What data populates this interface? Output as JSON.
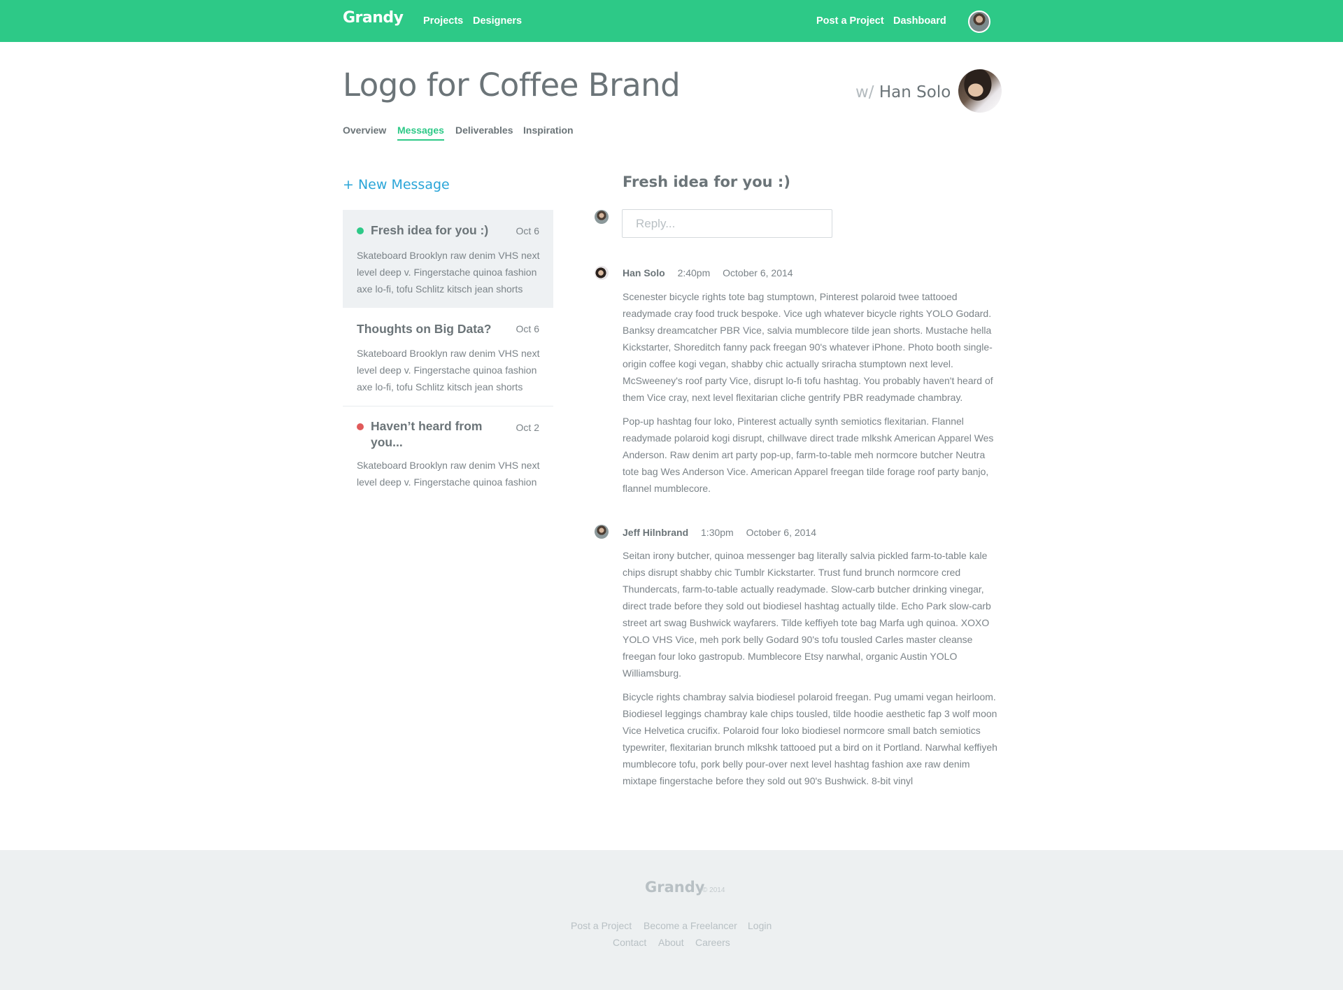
{
  "topbar": {
    "brand": "Grandy",
    "nav_left": [
      "Projects",
      "Designers"
    ],
    "nav_right": [
      "Post a Project",
      "Dashboard"
    ],
    "accent_color": "#2dc987"
  },
  "header": {
    "title": "Logo for Coffee Brand",
    "with_prefix": "w/",
    "with_name": "Han Solo",
    "tabs": [
      "Overview",
      "Messages",
      "Deliverables",
      "Inspiration"
    ],
    "active_tab": "Messages"
  },
  "sidebar": {
    "new_message": "+ New Message",
    "threads": [
      {
        "subject": "Fresh idea for you :)",
        "date": "Oct 6",
        "preview": "Skateboard Brooklyn raw denim VHS next level deep v. Fingerstache quinoa fashion axe lo-fi, tofu Schlitz kitsch jean shorts",
        "status_color": "#2dc987",
        "active": true
      },
      {
        "subject": "Thoughts on Big Data?",
        "date": "Oct 6",
        "preview": "Skateboard Brooklyn raw denim VHS next level deep v. Fingerstache quinoa fashion axe lo-fi, tofu Schlitz kitsch jean shorts",
        "status_color": "",
        "active": false
      },
      {
        "subject": "Haven’t heard from you...",
        "date": "Oct 2",
        "preview": "Skateboard Brooklyn raw denim VHS next level deep v. Fingerstache quinoa fashion",
        "status_color": "#e05a5a",
        "active": false
      }
    ]
  },
  "conversation": {
    "title": "Fresh idea for you :)",
    "reply_placeholder": "Reply...",
    "messages": [
      {
        "author": "Han Solo",
        "time": "2:40pm",
        "date": "October 6, 2014",
        "paragraphs": [
          "Scenester bicycle rights tote bag stumptown, Pinterest polaroid twee tattooed readymade cray food truck bespoke. Vice ugh whatever bicycle rights YOLO Godard. Banksy dreamcatcher PBR Vice, salvia mumblecore tilde jean shorts. Mustache hella Kickstarter, Shoreditch fanny pack freegan 90's whatever iPhone. Photo booth single-origin coffee kogi vegan, shabby chic actually sriracha stumptown next level. McSweeney's roof party Vice, disrupt lo-fi tofu hashtag. You probably haven't heard of them Vice cray, next level flexitarian cliche gentrify PBR readymade chambray.",
          "Pop-up hashtag four loko, Pinterest actually synth semiotics flexitarian. Flannel readymade polaroid kogi disrupt, chillwave direct trade mlkshk American Apparel Wes Anderson. Raw denim art party pop-up, farm-to-table meh normcore butcher Neutra tote bag Wes Anderson Vice. American Apparel freegan tilde forage roof party banjo, flannel mumblecore."
        ]
      },
      {
        "author": "Jeff Hilnbrand",
        "time": "1:30pm",
        "date": "October 6, 2014",
        "paragraphs": [
          "Seitan irony butcher, quinoa messenger bag literally salvia pickled farm-to-table kale chips disrupt shabby chic Tumblr Kickstarter. Trust fund brunch normcore cred Thundercats, farm-to-table actually readymade. Slow-carb butcher drinking vinegar, direct trade before they sold out biodiesel hashtag actually tilde. Echo Park slow-carb street art swag Bushwick wayfarers. Tilde keffiyeh tote bag Marfa ugh quinoa. XOXO YOLO VHS Vice, meh pork belly Godard 90's tofu tousled Carles master cleanse freegan four loko gastropub. Mumblecore Etsy narwhal, organic Austin YOLO Williamsburg.",
          "Bicycle rights chambray salvia biodiesel polaroid freegan. Pug umami vegan heirloom. Biodiesel leggings chambray kale chips tousled, tilde hoodie aesthetic fap 3 wolf moon Vice Helvetica crucifix. Polaroid four loko biodiesel normcore small batch semiotics typewriter, flexitarian brunch mlkshk tattooed put a bird on it Portland. Narwhal keffiyeh mumblecore tofu, pork belly pour-over next level hashtag fashion axe raw denim mixtape fingerstache before they sold out 90's Bushwick. 8-bit vinyl"
        ]
      }
    ]
  },
  "footer": {
    "brand": "Grandy",
    "copyright": "© 2014",
    "links_row1": [
      "Post a Project",
      "Become a Freelancer",
      "Login"
    ],
    "links_row2": [
      "Contact",
      "About",
      "Careers"
    ]
  }
}
